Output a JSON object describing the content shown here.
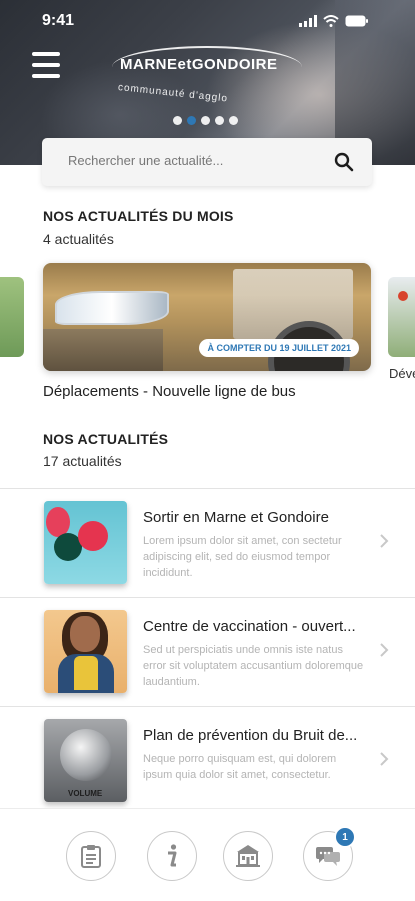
{
  "status_bar": {
    "time": "9:41"
  },
  "header": {
    "logo_line1": "MARNEetGONDOIRE",
    "logo_line2": "communauté d'agglo",
    "carousel_dots": 5,
    "active_dot": 1
  },
  "search": {
    "placeholder": "Rechercher une actualité..."
  },
  "month_section": {
    "title": "NOS ACTUALITÉS DU MOIS",
    "count": "4 actualités",
    "featured": {
      "badge": "À COMPTER DU 19 JUILLET 2021",
      "title": "Déplacements - Nouvelle ligne de bus"
    },
    "next_card_label": "Déve"
  },
  "news_section": {
    "title": "NOS ACTUALITÉS",
    "count": "17 actualités",
    "items": [
      {
        "title": "Sortir en Marne et Gondoire",
        "description": "Lorem ipsum dolor sit amet, con sectetur adipiscing elit, sed do eiusmod tempor incididunt."
      },
      {
        "title": "Centre de vaccination - ouvert...",
        "description": "Sed ut perspiciatis unde omnis iste natus error sit voluptatem accusantium doloremque laudantium."
      },
      {
        "title": "Plan de prévention du Bruit de...",
        "description": "Neque porro quisquam est, qui dolorem ipsum quia dolor sit amet, consectetur."
      }
    ],
    "thumb3_label": "VOLUME"
  },
  "tabbar": {
    "tabs": [
      "clipboard-icon",
      "info-icon",
      "town-hall-icon",
      "chat-icon"
    ],
    "chat_badge": "1"
  },
  "colors": {
    "accent": "#2e78b5"
  }
}
